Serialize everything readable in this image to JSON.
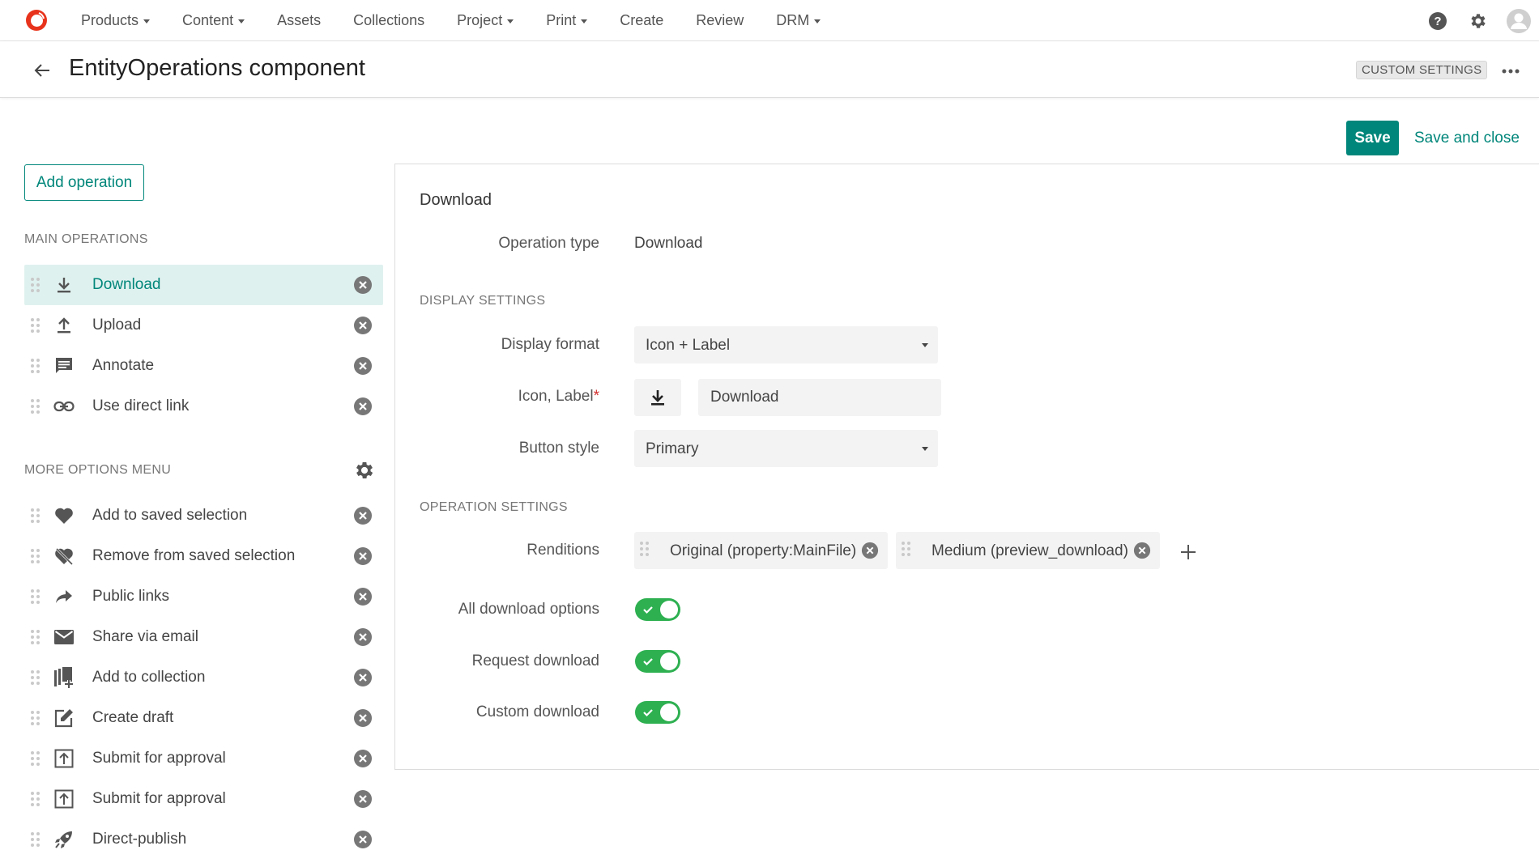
{
  "nav": {
    "items": [
      {
        "label": "Products",
        "dropdown": true
      },
      {
        "label": "Content",
        "dropdown": true
      },
      {
        "label": "Assets",
        "dropdown": false
      },
      {
        "label": "Collections",
        "dropdown": false
      },
      {
        "label": "Project",
        "dropdown": true
      },
      {
        "label": "Print",
        "dropdown": true
      },
      {
        "label": "Create",
        "dropdown": false
      },
      {
        "label": "Review",
        "dropdown": false
      },
      {
        "label": "DRM",
        "dropdown": true
      }
    ],
    "right_icons": [
      "help-icon",
      "gear-icon",
      "user-avatar-icon"
    ]
  },
  "header": {
    "title": "EntityOperations component",
    "badge": "CUSTOM SETTINGS"
  },
  "actions": {
    "save_label": "Save",
    "save_close_label": "Save and close"
  },
  "sidebar": {
    "add_operation_label": "Add operation",
    "main_operations_label": "MAIN OPERATIONS",
    "more_options_label": "MORE OPTIONS MENU",
    "main_operations": [
      {
        "label": "Download",
        "icon": "download-icon",
        "active": true
      },
      {
        "label": "Upload",
        "icon": "upload-icon",
        "active": false
      },
      {
        "label": "Annotate",
        "icon": "comment-icon",
        "active": false
      },
      {
        "label": "Use direct link",
        "icon": "link-icon",
        "active": false
      }
    ],
    "more_options": [
      {
        "label": "Add to saved selection",
        "icon": "heart-icon"
      },
      {
        "label": "Remove from saved selection",
        "icon": "heart-broken-icon"
      },
      {
        "label": "Public links",
        "icon": "share-arrow-icon"
      },
      {
        "label": "Share via email",
        "icon": "email-icon"
      },
      {
        "label": "Add to collection",
        "icon": "collection-add-icon"
      },
      {
        "label": "Create draft",
        "icon": "edit-icon"
      },
      {
        "label": "Submit for approval",
        "icon": "submit-icon"
      },
      {
        "label": "Submit for approval",
        "icon": "submit-icon"
      },
      {
        "label": "Direct-publish",
        "icon": "rocket-icon"
      }
    ]
  },
  "panel": {
    "title": "Download",
    "operation_type_label": "Operation type",
    "operation_type_value": "Download",
    "display_settings_label": "DISPLAY SETTINGS",
    "display_format_label": "Display format",
    "display_format_value": "Icon + Label",
    "icon_label_label": "Icon, Label",
    "icon_label_required": "*",
    "icon_value": "download-icon",
    "label_value": "Download",
    "button_style_label": "Button style",
    "button_style_value": "Primary",
    "operation_settings_label": "OPERATION SETTINGS",
    "renditions_label": "Renditions",
    "renditions": [
      "Original (property:MainFile)",
      "Medium (preview_download)"
    ],
    "toggles": [
      {
        "label": "All download options",
        "on": true
      },
      {
        "label": "Request download",
        "on": true
      },
      {
        "label": "Custom download",
        "on": true
      }
    ]
  },
  "colors": {
    "accent": "#00867a",
    "active_bg": "#dff1ef",
    "toggle_on": "#2eb051",
    "logo": "#e8331c"
  }
}
